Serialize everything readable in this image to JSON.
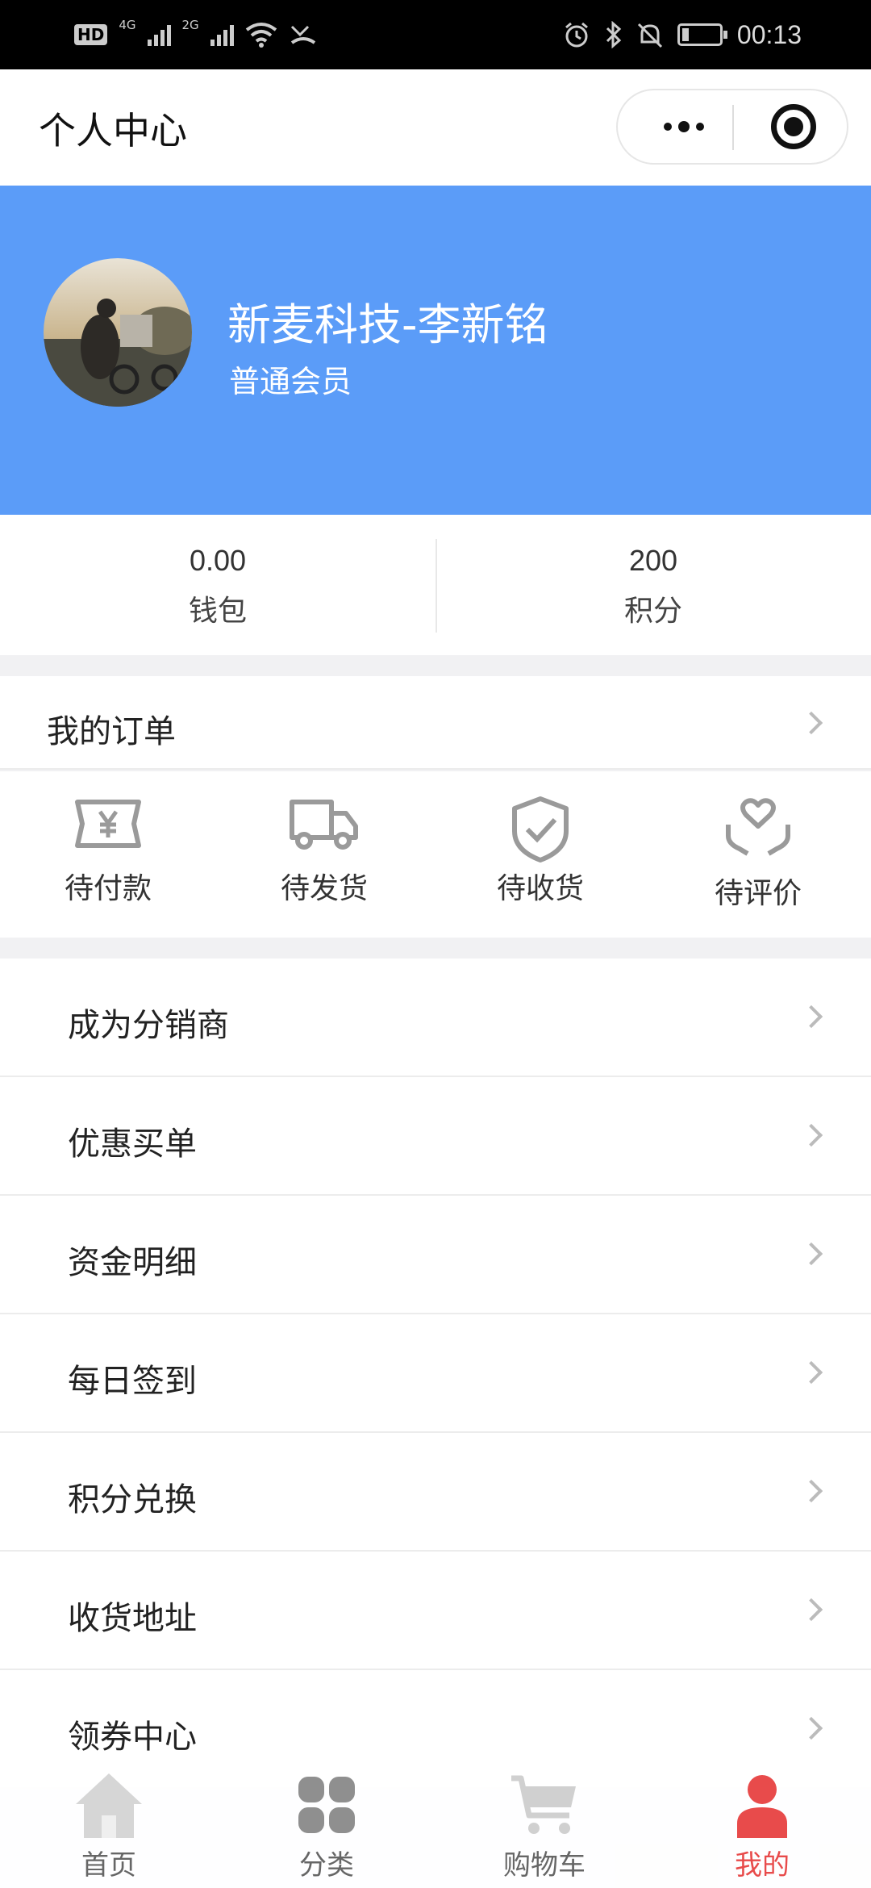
{
  "status_bar": {
    "hd": "HD",
    "net1": "4G",
    "net2": "2G",
    "time": "00:13"
  },
  "nav": {
    "title": "个人中心"
  },
  "profile": {
    "name": "新麦科技-李新铭",
    "level": "普通会员"
  },
  "stats": [
    {
      "value": "0.00",
      "label": "钱包"
    },
    {
      "value": "200",
      "label": "积分"
    }
  ],
  "orders": {
    "title": "我的订单",
    "items": [
      {
        "label": "待付款",
        "icon": "ticket-yen-icon"
      },
      {
        "label": "待发货",
        "icon": "truck-icon"
      },
      {
        "label": "待收货",
        "icon": "shield-check-icon"
      },
      {
        "label": "待评价",
        "icon": "heart-hand-icon"
      }
    ]
  },
  "menu": [
    {
      "label": "成为分销商"
    },
    {
      "label": "优惠买单"
    },
    {
      "label": "资金明细"
    },
    {
      "label": "每日签到"
    },
    {
      "label": "积分兑换"
    },
    {
      "label": "收货地址"
    },
    {
      "label": "领券中心"
    }
  ],
  "tabbar": [
    {
      "label": "首页",
      "icon": "home-icon"
    },
    {
      "label": "分类",
      "icon": "grid-icon"
    },
    {
      "label": "购物车",
      "icon": "cart-icon"
    },
    {
      "label": "我的",
      "icon": "user-icon",
      "active": true
    }
  ],
  "colors": {
    "header_bg": "#5b9cf8",
    "active_tab": "#e84b4b",
    "icon_gray": "#9a9a9a"
  }
}
